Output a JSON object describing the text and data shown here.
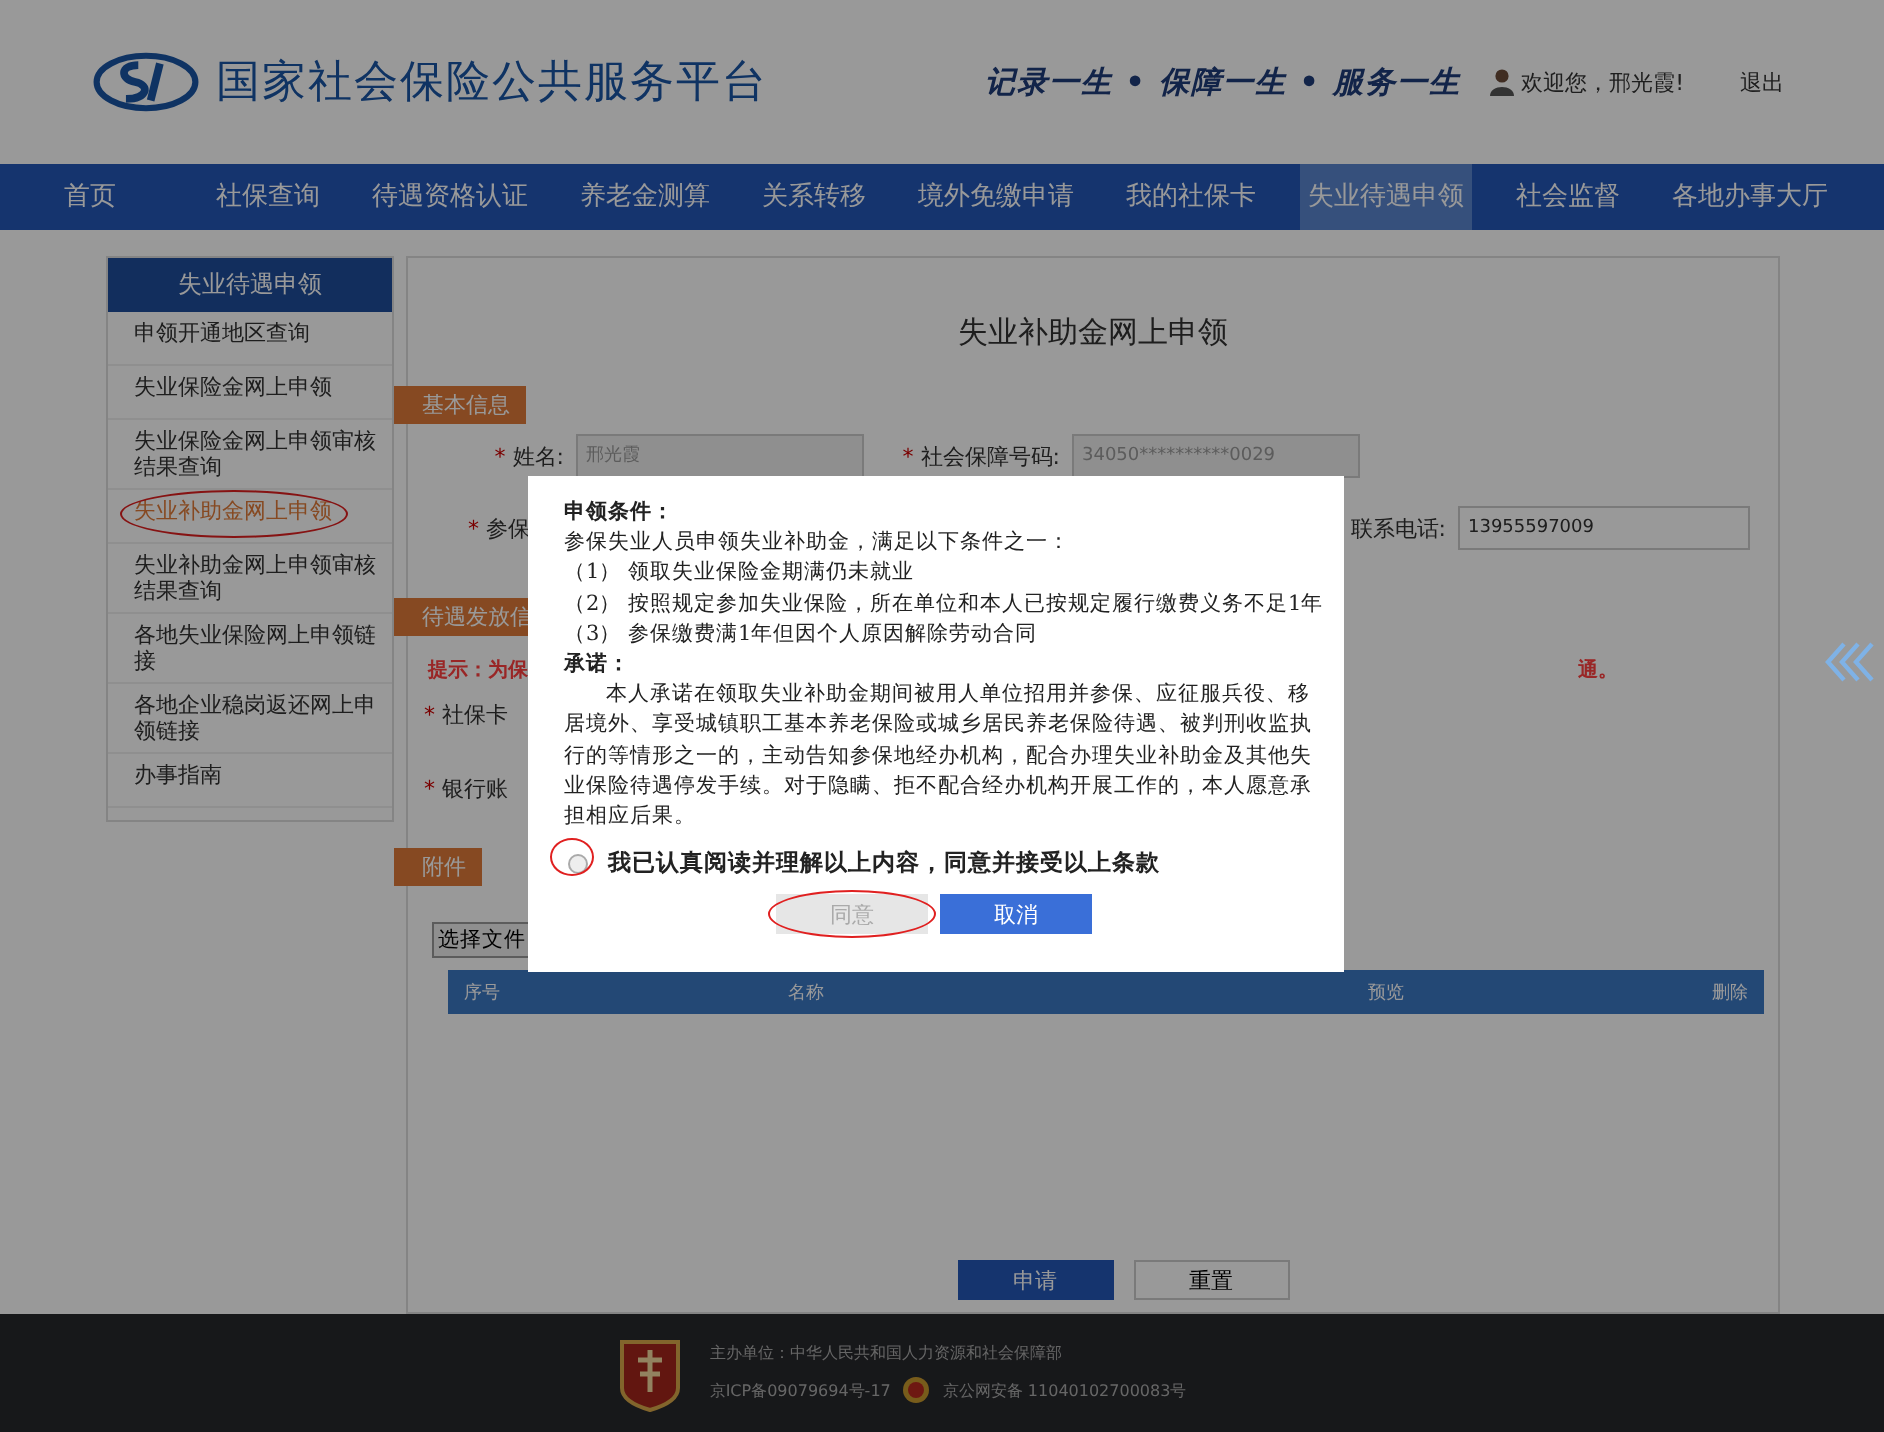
{
  "header": {
    "site_title": "国家社会保险公共服务平台",
    "slogan": "记录一生 • 保障一生 • 服务一生",
    "greeting": "欢迎您，邢光霞!",
    "logout": "退出"
  },
  "nav": [
    {
      "label": "首页",
      "selected": false
    },
    {
      "label": "社保查询",
      "selected": false
    },
    {
      "label": "待遇资格认证",
      "selected": false
    },
    {
      "label": "养老金测算",
      "selected": false
    },
    {
      "label": "关系转移",
      "selected": false
    },
    {
      "label": "境外免缴申请",
      "selected": false
    },
    {
      "label": "我的社保卡",
      "selected": false
    },
    {
      "label": "失业待遇申领",
      "selected": true
    },
    {
      "label": "社会监督",
      "selected": false
    },
    {
      "label": "各地办事大厅",
      "selected": false
    }
  ],
  "sidebar": {
    "title": "失业待遇申领",
    "items": [
      {
        "label": "申领开通地区查询",
        "selected": false,
        "circled": false
      },
      {
        "label": "失业保险金网上申领",
        "selected": false,
        "circled": false
      },
      {
        "label": "失业保险金网上申领审核结果查询",
        "selected": false,
        "circled": false
      },
      {
        "label": "失业补助金网上申领",
        "selected": true,
        "circled": true
      },
      {
        "label": "失业补助金网上申领审核结果查询",
        "selected": false,
        "circled": false
      },
      {
        "label": "各地失业保险网上申领链接",
        "selected": false,
        "circled": false
      },
      {
        "label": "各地企业稳岗返还网上申领链接",
        "selected": false,
        "circled": false
      },
      {
        "label": "办事指南",
        "selected": false,
        "circled": false
      }
    ]
  },
  "form": {
    "title": "失业补助金网上申领",
    "required_mark": "*",
    "basic_section": "基本信息",
    "name_label": "姓名:",
    "name_value": "邢光霞",
    "ssn_label": "社会保障号码:",
    "ssn_value": "34050**********0029",
    "insured_label": "参保",
    "phone_label": "联系电话:",
    "phone_value": "13955597009",
    "payment_section": "待遇发放信",
    "tip": "提示：为保",
    "tip_end": "通。",
    "card_label": "社保卡",
    "bank_label": "银行账",
    "attachment_section": "附件",
    "choose_file": "选择文件",
    "columns": [
      "序号",
      "名称",
      "预览",
      "删除"
    ],
    "submit": "申请",
    "reset": "重置"
  },
  "modal": {
    "conditions_heading": "申领条件：",
    "conditions_intro": "参保失业人员申领失业补助金，满足以下条件之一：",
    "conditions": [
      "（1） 领取失业保险金期满仍未就业",
      "（2） 按照规定参加失业保险，所在单位和本人已按规定履行缴费义务不足1年",
      "（3） 参保缴费满1年但因个人原因解除劳动合同"
    ],
    "pledge_heading": "承诺：",
    "pledge_text": "本人承诺在领取失业补助金期间被用人单位招用并参保、应征服兵役、移居境外、享受城镇职工基本养老保险或城乡居民养老保险待遇、被判刑收监执行的等情形之一的，主动告知参保地经办机构，配合办理失业补助金及其他失业保险待遇停发手续。对于隐瞒、拒不配合经办机构开展工作的，本人愿意承担相应后果。",
    "agree_label": "我已认真阅读并理解以上内容，同意并接受以上条款",
    "agree_checked": false,
    "agree_circled": true,
    "buttons": [
      {
        "label": "同意",
        "kind": "disabled",
        "circled": true
      },
      {
        "label": "取消",
        "kind": "primary",
        "circled": false
      }
    ]
  },
  "footer": {
    "sponsor": "主办单位：中华人民共和国人力资源和社会保障部",
    "icp": "京ICP备09079694号-17",
    "police": "京公网安备 11040102700083号"
  }
}
